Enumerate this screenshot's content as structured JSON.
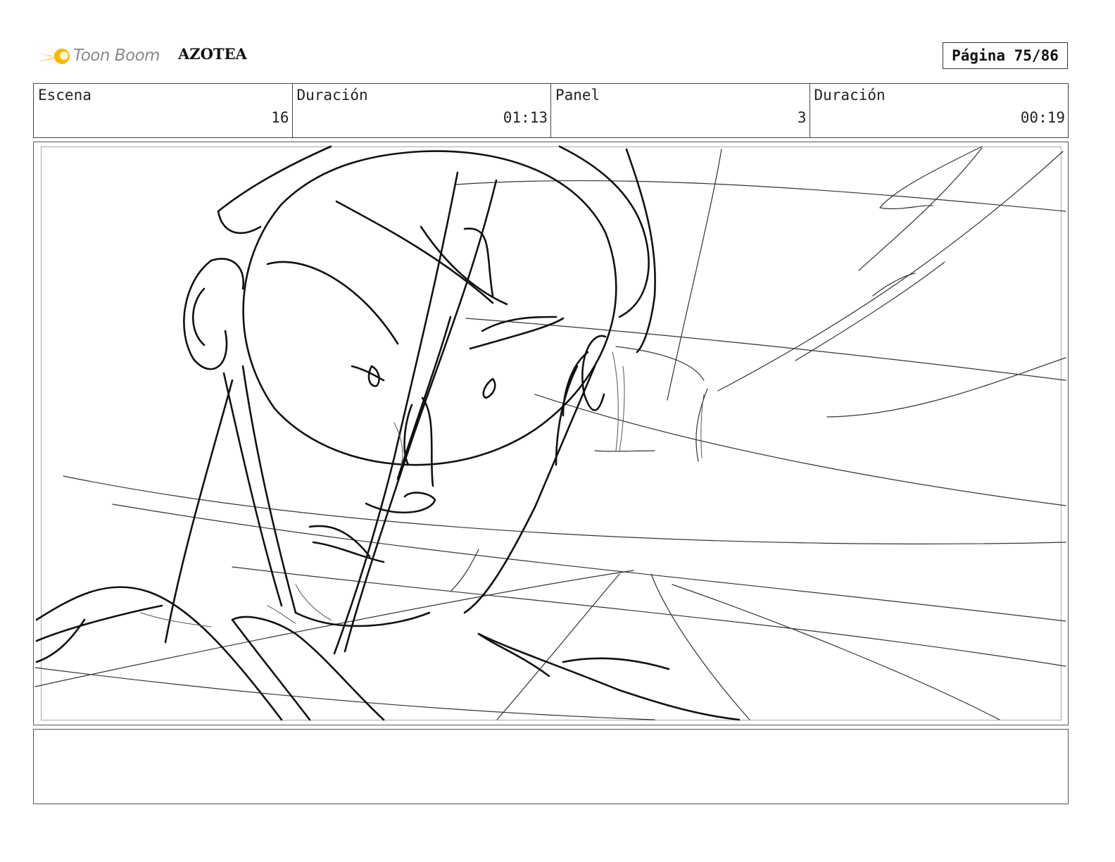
{
  "header": {
    "logo_text": "Toon Boom",
    "project_title": "AZOTEA",
    "page_label": "Página 75/86"
  },
  "info": [
    {
      "label": "Escena",
      "value": "16"
    },
    {
      "label": "Duración",
      "value": "01:13"
    },
    {
      "label": "Panel",
      "value": "3"
    },
    {
      "label": "Duración",
      "value": "00:19"
    }
  ],
  "notes": {
    "text": ""
  },
  "colors": {
    "logo_accent": "#f5b800",
    "logo_text": "#8a8a8a",
    "sketch_line": "#111111"
  }
}
